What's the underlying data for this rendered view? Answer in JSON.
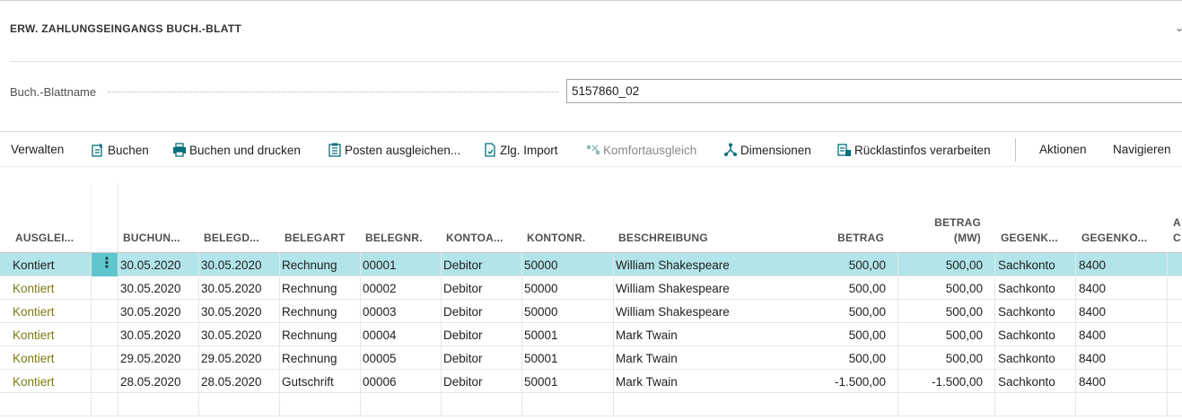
{
  "header": {
    "title": "ERW. ZAHLUNGSEINGANGS BUCH.-BLATT"
  },
  "field": {
    "label": "Buch.-Blattname",
    "value": "5157860_02"
  },
  "actions": [
    {
      "label": "Verwalten",
      "icon": "none"
    },
    {
      "label": "Buchen",
      "icon": "post-icon"
    },
    {
      "label": "Buchen und drucken",
      "icon": "print-icon"
    },
    {
      "label": "Posten ausgleichen...",
      "icon": "apply-entries-icon"
    },
    {
      "label": "Zlg. Import",
      "icon": "import-icon"
    },
    {
      "label": "Komfortausgleich",
      "icon": "comfort-apply-icon",
      "disabled": true
    },
    {
      "label": "Dimensionen",
      "icon": "dimensions-icon"
    },
    {
      "label": "Rücklastinfos verarbeiten",
      "icon": "return-info-icon"
    },
    {
      "label": "Aktionen",
      "icon": "none"
    },
    {
      "label": "Navigieren",
      "icon": "none"
    }
  ],
  "columns": {
    "ausgleich": "AUSGLEI...",
    "buchungsdatum": "BUCHUN...",
    "belegdatum": "BELEGD...",
    "belegart": "BELEGART",
    "belegnr": "BELEGNR.",
    "kontoart": "KONTOA...",
    "kontonr": "KONTONR.",
    "beschreibung": "BESCHREIBUNG",
    "betrag": "BETRAG",
    "betrag_mw_1": "BETRAG",
    "betrag_mw_2": "(MW)",
    "gegenkontoart": "GEGENK...",
    "gegenkontonr": "GEGENKO...",
    "cut_1": "A",
    "cut_2": "C"
  },
  "rows": [
    {
      "status": "Kontiert",
      "buchungsdatum": "30.05.2020",
      "belegdatum": "30.05.2020",
      "belegart": "Rechnung",
      "belegnr": "00001",
      "kontoart": "Debitor",
      "kontonr": "50000",
      "beschreibung": "William Shakespeare",
      "betrag": "500,00",
      "betrag_mw": "500,00",
      "gegenkontoart": "Sachkonto",
      "gegenkontonr": "8400"
    },
    {
      "status": "Kontiert",
      "buchungsdatum": "30.05.2020",
      "belegdatum": "30.05.2020",
      "belegart": "Rechnung",
      "belegnr": "00002",
      "kontoart": "Debitor",
      "kontonr": "50000",
      "beschreibung": "William Shakespeare",
      "betrag": "500,00",
      "betrag_mw": "500,00",
      "gegenkontoart": "Sachkonto",
      "gegenkontonr": "8400"
    },
    {
      "status": "Kontiert",
      "buchungsdatum": "30.05.2020",
      "belegdatum": "30.05.2020",
      "belegart": "Rechnung",
      "belegnr": "00003",
      "kontoart": "Debitor",
      "kontonr": "50000",
      "beschreibung": "William Shakespeare",
      "betrag": "500,00",
      "betrag_mw": "500,00",
      "gegenkontoart": "Sachkonto",
      "gegenkontonr": "8400"
    },
    {
      "status": "Kontiert",
      "buchungsdatum": "30.05.2020",
      "belegdatum": "30.05.2020",
      "belegart": "Rechnung",
      "belegnr": "00004",
      "kontoart": "Debitor",
      "kontonr": "50001",
      "beschreibung": "Mark Twain",
      "betrag": "500,00",
      "betrag_mw": "500,00",
      "gegenkontoart": "Sachkonto",
      "gegenkontonr": "8400"
    },
    {
      "status": "Kontiert",
      "buchungsdatum": "29.05.2020",
      "belegdatum": "29.05.2020",
      "belegart": "Rechnung",
      "belegnr": "00005",
      "kontoart": "Debitor",
      "kontonr": "50001",
      "beschreibung": "Mark Twain",
      "betrag": "500,00",
      "betrag_mw": "500,00",
      "gegenkontoart": "Sachkonto",
      "gegenkontonr": "8400"
    },
    {
      "status": "Kontiert",
      "buchungsdatum": "28.05.2020",
      "belegdatum": "28.05.2020",
      "belegart": "Gutschrift",
      "belegnr": "00006",
      "kontoart": "Debitor",
      "kontonr": "50001",
      "beschreibung": "Mark Twain",
      "betrag": "-1.500,00",
      "betrag_mw": "-1.500,00",
      "gegenkontoart": "Sachkonto",
      "gegenkontonr": "8400"
    }
  ],
  "colors": {
    "selected_row": "#b2e5ea",
    "row_menu": "#5fc6cf",
    "status_text": "#7a7a12",
    "icon_accent": "#00707c"
  }
}
